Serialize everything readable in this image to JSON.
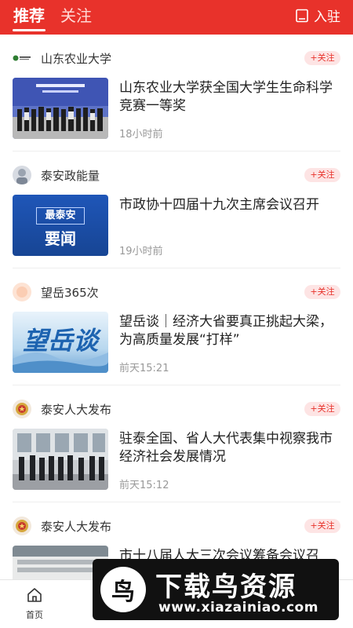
{
  "header": {
    "tabs": [
      {
        "label": "推荐",
        "active": true
      },
      {
        "label": "关注",
        "active": false
      }
    ],
    "settle_label": "入驻",
    "accent_color": "#e8322b"
  },
  "feed": [
    {
      "source": "山东农业大学",
      "follow": "+关注",
      "title": "山东农业大学获全国大学生生命科学竞赛一等奖",
      "time": "18小时前",
      "avatar_icon": "university-logo-icon"
    },
    {
      "source": "泰安政能量",
      "follow": "+关注",
      "title": "市政协十四届十九次主席会议召开",
      "time": "19小时前",
      "avatar_icon": "org-avatar-icon",
      "thumb_text": [
        "最泰安",
        "要闻"
      ]
    },
    {
      "source": "望岳365次",
      "follow": "+关注",
      "title": "望岳谈｜经济大省要真正挑起大梁，为高质量发展“打样”",
      "time": "前天15:21",
      "avatar_icon": "org-avatar-icon",
      "thumb_text": [
        "望岳谈"
      ]
    },
    {
      "source": "泰安人大发布",
      "follow": "+关注",
      "title": "驻泰全国、省人大代表集中视察我市经济社会发展情况",
      "time": "前天15:12",
      "avatar_icon": "emblem-icon"
    },
    {
      "source": "泰安人大发布",
      "follow": "+关注",
      "title": "市十八届人大三次会议筹备会议召",
      "time": "",
      "avatar_icon": "emblem-icon"
    }
  ],
  "bottom_nav": {
    "home_label": "首页"
  },
  "watermark": {
    "logo_char": "鸟",
    "title": "下载鸟资源",
    "url": "www.xiazainiao.com"
  }
}
